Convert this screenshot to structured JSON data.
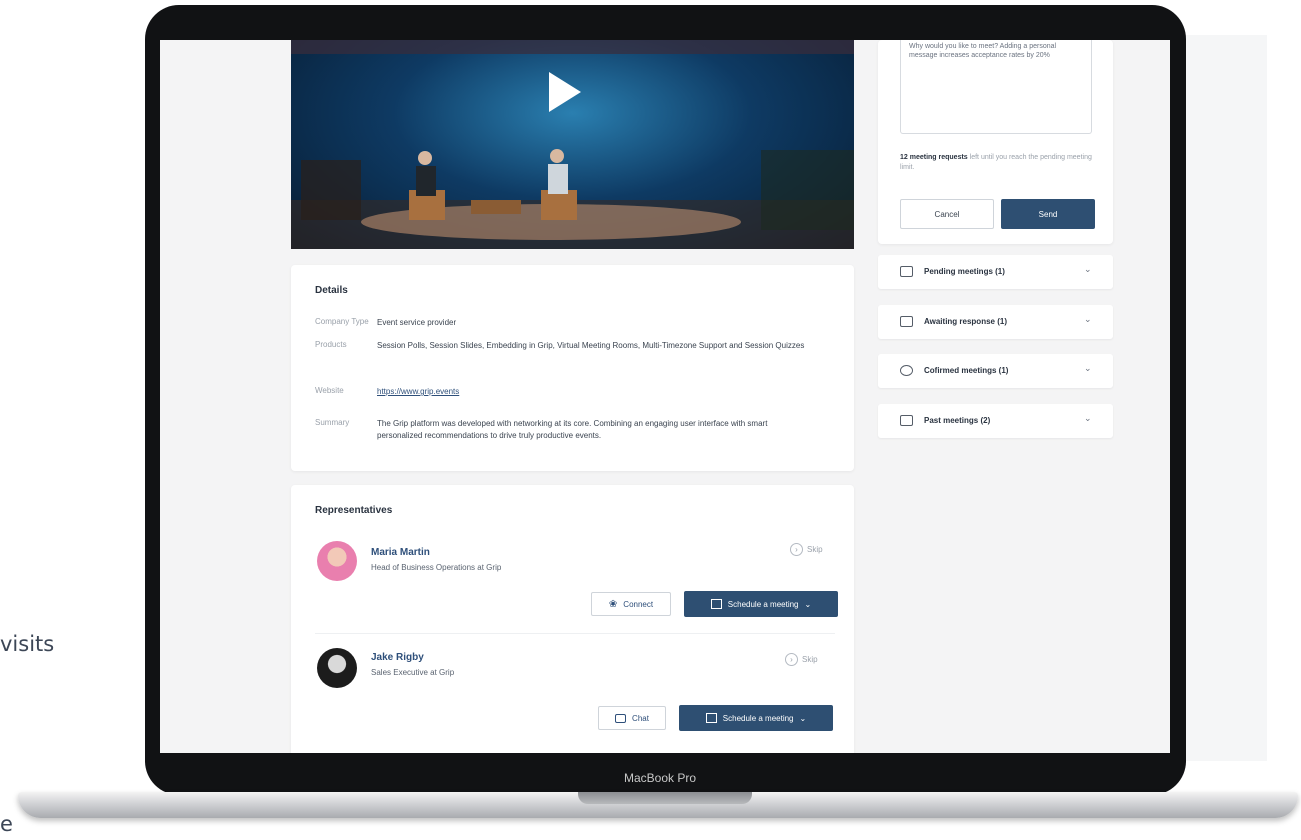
{
  "side_text": {
    "visits": "visits",
    "e": "e"
  },
  "device": {
    "label": "MacBook Pro"
  },
  "meeting_request": {
    "textarea_text": "Why would you like to meet? Adding a personal message increases acceptance rates by 20%",
    "requests_left_count": "12 meeting requests",
    "requests_left_rest": "left until you reach the pending meeting limit.",
    "cancel_label": "Cancel",
    "send_label": "Send"
  },
  "meetings": [
    {
      "label": "Pending meetings (1)",
      "icon": "envelope-icon"
    },
    {
      "label": "Awaiting response (1)",
      "icon": "chat-bubble-icon"
    },
    {
      "label": "Cofirmed meetings (1)",
      "icon": "check-circle-icon"
    },
    {
      "label": "Past meetings (2)",
      "icon": "archive-icon"
    }
  ],
  "details": {
    "title": "Details",
    "rows": [
      {
        "label": "Company Type",
        "value": "Event service provider"
      },
      {
        "label": "Products",
        "value": "Session Polls, Session Slides, Embedding in Grip, Virtual Meeting Rooms, Multi-Timezone Support and Session Quizzes"
      },
      {
        "label": "Website",
        "value": "https://www.grip.events"
      },
      {
        "label": "Summary",
        "value": "The Grip platform was developed with networking at its core. Combining an engaging user interface with smart personalized recommendations to drive truly productive events."
      }
    ]
  },
  "representatives": {
    "title": "Representatives",
    "people": [
      {
        "name": "Maria Martin",
        "title": "Head of Business Operations at Grip",
        "skip": "Skip",
        "secondary": "Connect",
        "schedule": "Schedule a meeting"
      },
      {
        "name": "Jake Rigby",
        "title": "Sales Executive at Grip",
        "skip": "Skip",
        "secondary": "Chat",
        "schedule": "Schedule a meeting"
      }
    ]
  },
  "colors": {
    "primary": "#2e4f72",
    "link": "#2e4f7a",
    "text": "#2a3340"
  }
}
